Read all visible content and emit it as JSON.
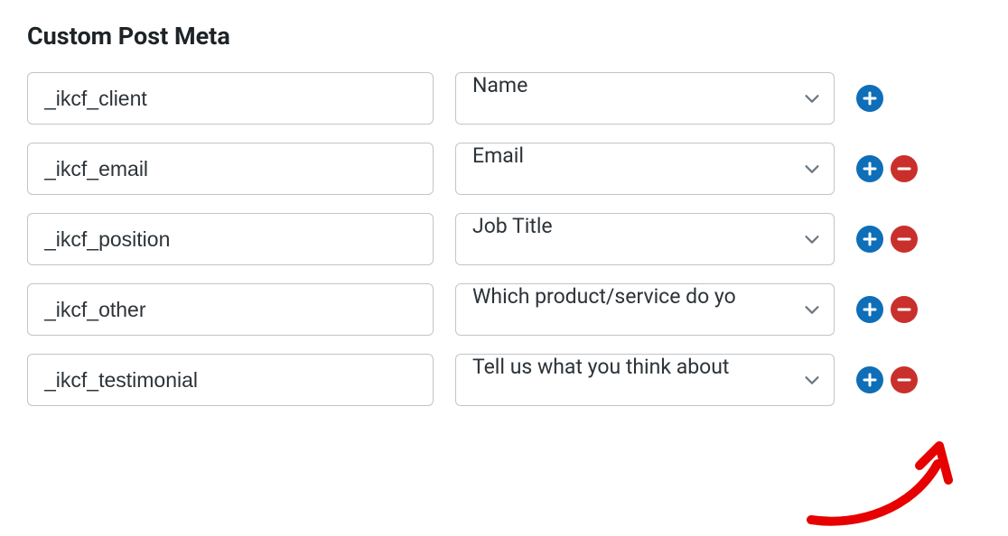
{
  "section_title": "Custom Post Meta",
  "rows": [
    {
      "key": "_ikcf_client",
      "field": "Name",
      "show_remove": false
    },
    {
      "key": "_ikcf_email",
      "field": "Email",
      "show_remove": true
    },
    {
      "key": "_ikcf_position",
      "field": "Job Title",
      "show_remove": true
    },
    {
      "key": "_ikcf_other",
      "field": "Which product/service do yo",
      "show_remove": true
    },
    {
      "key": "_ikcf_testimonial",
      "field": "Tell us what you think about",
      "show_remove": true
    }
  ],
  "colors": {
    "add_bg": "#0e6eb8",
    "remove_bg": "#c9302c",
    "arrow": "#e60000",
    "chevron": "#6c7781"
  }
}
